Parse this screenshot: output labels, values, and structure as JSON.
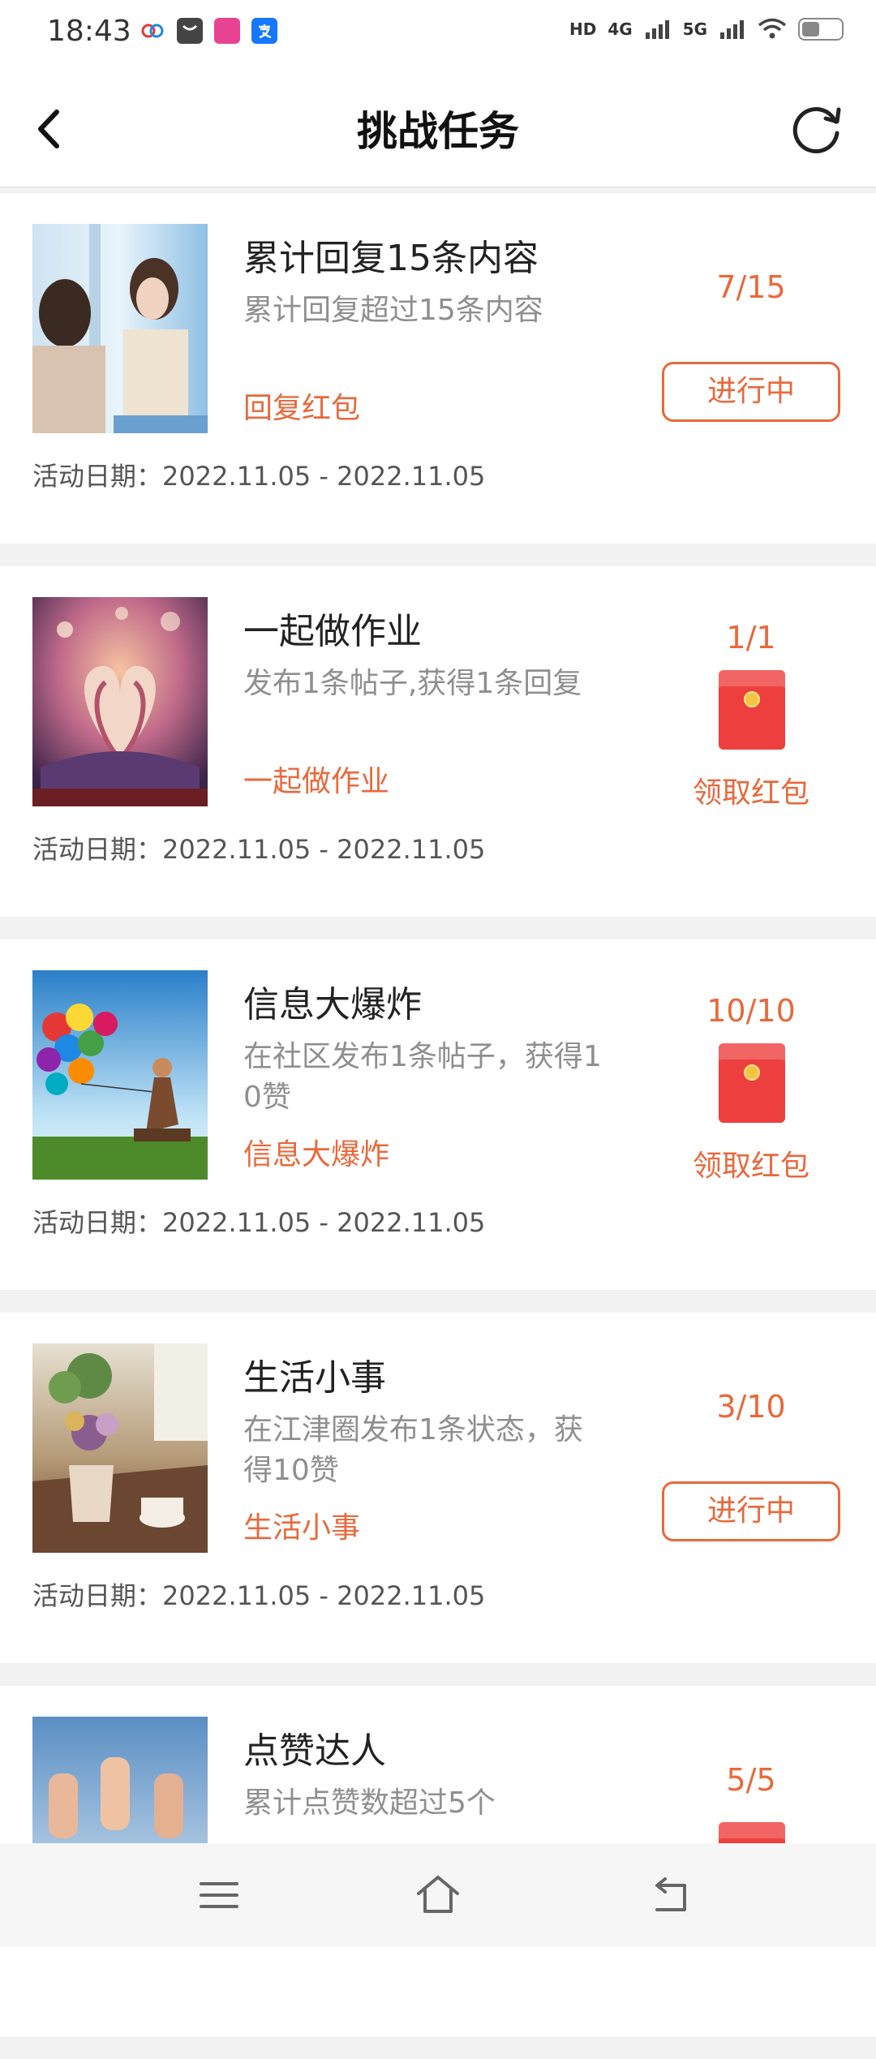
{
  "status_bar": {
    "time": "18:43",
    "app_icons": [
      "5g-app-icon",
      "message-app-icon",
      "shopping-app-icon",
      "alipay-icon"
    ],
    "network_labels": [
      "HD",
      "4G",
      "5G"
    ],
    "wifi_icon": "wifi-icon",
    "battery_level": 0.45
  },
  "nav": {
    "title": "挑战任务",
    "back_icon": "chevron-left-icon",
    "refresh_icon": "refresh-icon"
  },
  "date_label": "活动日期：",
  "tasks": [
    {
      "title": "累计回复15条内容",
      "description": "累计回复超过15条内容",
      "tag": "回复红包",
      "date_range": "2022.11.05 - 2022.11.05",
      "progress": "7/15",
      "state": "进行中"
    },
    {
      "title": "一起做作业",
      "description": "发布1条帖子,获得1条回复",
      "tag": "一起做作业",
      "date_range": "2022.11.05 - 2022.11.05",
      "progress": "1/1",
      "state": "领取红包"
    },
    {
      "title": "信息大爆炸",
      "description": "在社区发布1条帖子，获得1\n0赞",
      "tag": "信息大爆炸",
      "date_range": "2022.11.05 - 2022.11.05",
      "progress": "10/10",
      "state": "领取红包"
    },
    {
      "title": "生活小事",
      "description": "在江津圈发布1条状态，获\n得10赞",
      "tag": "生活小事",
      "date_range": "2022.11.05 - 2022.11.05",
      "progress": "3/10",
      "state": "进行中"
    },
    {
      "title": "点赞达人",
      "description": "累计点赞数超过5个",
      "progress": "5/5"
    }
  ],
  "colors": {
    "accent": "#e8693c",
    "redpacket": "#ee3f3f",
    "page_bg": "#f2f2f2"
  },
  "bottom_nav": {
    "icons": [
      "menu-icon",
      "home-icon",
      "back-icon"
    ]
  }
}
